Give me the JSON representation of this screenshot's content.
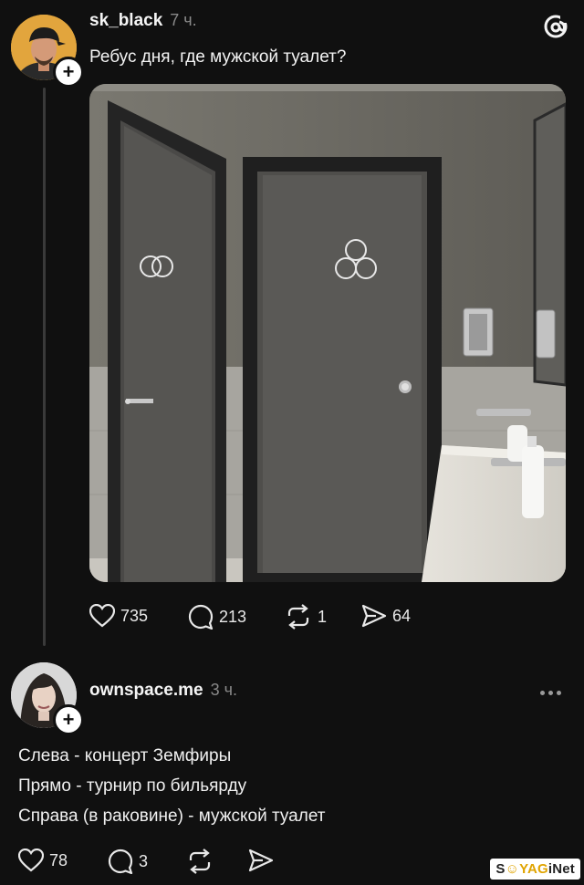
{
  "post": {
    "username": "sk_black",
    "time": "7 ч.",
    "text": "Ребус дня, где мужской туалет?",
    "actions": {
      "likes": "735",
      "comments": "213",
      "reposts": "1",
      "shares": "64"
    },
    "image_door_symbols": {
      "left": "two interlocking circles",
      "right": "three circles"
    }
  },
  "reply": {
    "username": "ownspace.me",
    "time": "3 ч.",
    "lines": [
      "Слева - концерт Земфиры",
      "Прямо - турнир по бильярду",
      "Справа (в раковине) - мужской туалет"
    ],
    "actions": {
      "likes": "78",
      "comments": "3"
    }
  },
  "watermark": {
    "prefix": "S",
    "middle": "YAG",
    "suffix": "iNet"
  },
  "icons": {
    "app_logo": "threads-logo-icon",
    "like": "heart-icon",
    "comment": "comment-bubble-icon",
    "repost": "repost-icon",
    "share": "send-icon",
    "more": "more-dots-icon",
    "follow": "plus-icon"
  },
  "colors": {
    "background": "#101010",
    "text": "#f3f3f3",
    "muted": "#8a8a8a",
    "thread_line": "#3a3a3a"
  }
}
